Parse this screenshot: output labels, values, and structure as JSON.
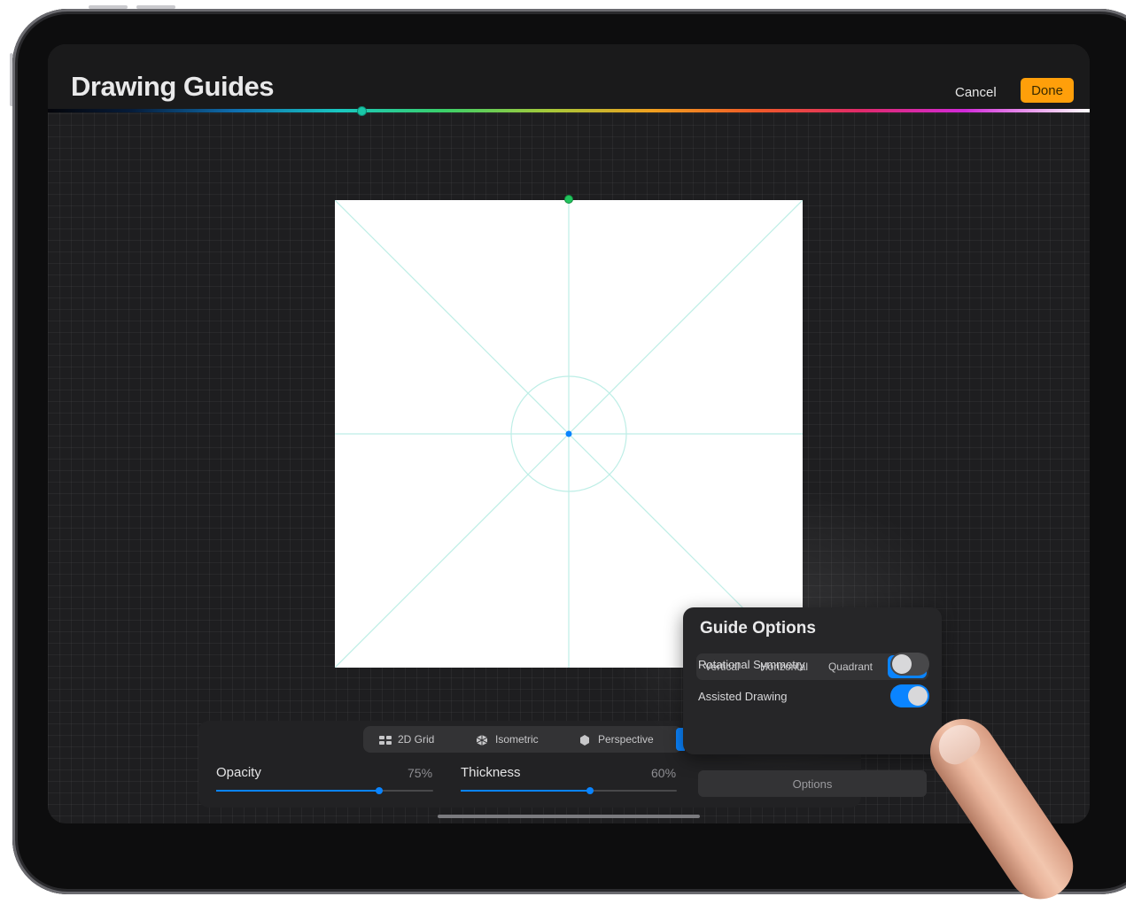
{
  "header": {
    "title": "Drawing Guides",
    "cancel_label": "Cancel",
    "done_label": "Done"
  },
  "guide_types": [
    {
      "label": "2D Grid",
      "icon": "grid-icon"
    },
    {
      "label": "Isometric",
      "icon": "isometric-icon"
    },
    {
      "label": "Perspective",
      "icon": "perspective-icon"
    }
  ],
  "sliders": {
    "opacity": {
      "label": "Opacity",
      "value": "75%",
      "fraction": 0.75
    },
    "thickness": {
      "label": "Thickness",
      "value": "60%",
      "fraction": 0.6
    }
  },
  "guide_options": {
    "title": "Guide Options",
    "modes": [
      "Vertical",
      "Horizontal",
      "Quadrant",
      "Radial"
    ],
    "selected_mode": "Radial",
    "rotational_symmetry": {
      "label": "Rotational Symmetry",
      "on": false
    },
    "assisted_drawing": {
      "label": "Assisted Drawing",
      "on": true
    },
    "options_label": "Options"
  },
  "colors": {
    "accent": "#0a84ff",
    "done": "#ff9f0a",
    "guide_line": "#bdeee6"
  }
}
